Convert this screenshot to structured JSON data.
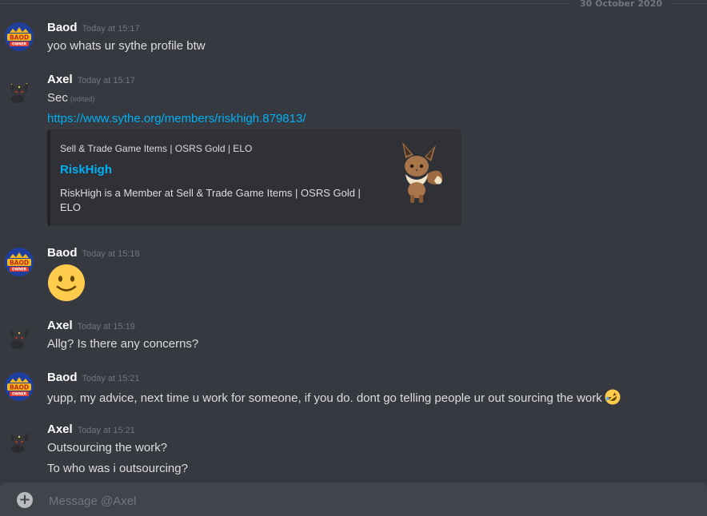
{
  "divider": {
    "date": "30 October 2020"
  },
  "messages": [
    {
      "author": "Baod",
      "timestamp": "Today at 15:17",
      "lines": [
        "yoo whats ur sythe profile btw"
      ]
    },
    {
      "author": "Axel",
      "timestamp": "Today at 15:17",
      "text": "Sec",
      "edited": "(edited)",
      "link": "https://www.sythe.org/members/riskhigh.879813/",
      "embed": {
        "provider": "Sell & Trade Game Items | OSRS Gold | ELO",
        "title": "RiskHigh",
        "description": "RiskHigh is a Member at Sell & Trade Game Items | OSRS Gold | ELO",
        "thumbnail_icon": "eevee-icon"
      }
    },
    {
      "author": "Baod",
      "timestamp": "Today at 15:18",
      "emoji": "slightly-smiling-face-emoji"
    },
    {
      "author": "Axel",
      "timestamp": "Today at 15:19",
      "lines": [
        "Allg? Is there any concerns?"
      ]
    },
    {
      "author": "Baod",
      "timestamp": "Today at 15:21",
      "lines": [
        "yupp, my advice, next time u work for someone, if you do. dont go telling people ur out sourcing the work"
      ],
      "emoji": "rolling-on-floor-laughing-emoji"
    },
    {
      "author": "Axel",
      "timestamp": "Today at 15:21",
      "lines": [
        "Outsourcing the work?",
        "To who was i outsourcing?"
      ]
    }
  ],
  "avatars": {
    "baod": {
      "badge_text_top": "BAOD",
      "badge_text_bottom": "OWNER",
      "colors": [
        "#1f3f9c",
        "#f2b81d",
        "#e03a2f"
      ]
    },
    "axel": {
      "icon": "umbreon-icon"
    }
  },
  "composer": {
    "placeholder": "Message @Axel",
    "plus_icon": "plus-circle-icon"
  },
  "colors": {
    "background": "#36393f",
    "link": "#00b0f4",
    "composer": "#40444b",
    "embed": "#2f3136"
  }
}
